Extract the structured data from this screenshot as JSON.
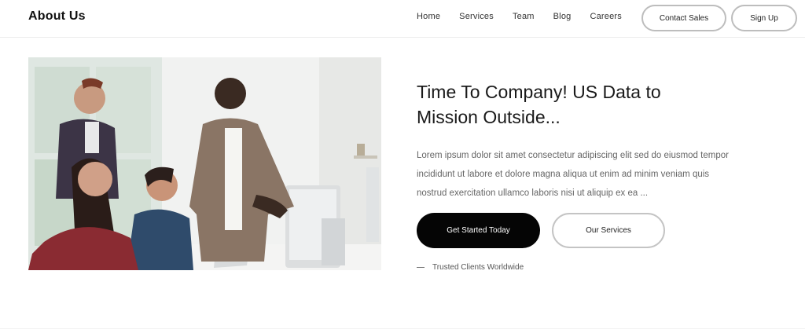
{
  "header": {
    "brand": "About Us",
    "nav": [
      "Home",
      "Services",
      "Team",
      "Blog",
      "Careers"
    ],
    "contact_label": "Contact Sales",
    "signup_label": "Sign Up"
  },
  "hero": {
    "title_lines": [
      "Time To Company! US Data to",
      "Mission Outside..."
    ],
    "body_lines": [
      "Lorem ipsum dolor sit amet consectetur adipiscing elit sed do eiusmod tempor",
      "incididunt ut labore et dolore magna aliqua ut enim ad minim veniam quis",
      "nostrud exercitation ullamco laboris nisi ut aliquip ex ea ..."
    ],
    "primary_label": "Get Started Today",
    "secondary_label": "Our Services",
    "footnote": "Trusted Clients Worldwide"
  }
}
